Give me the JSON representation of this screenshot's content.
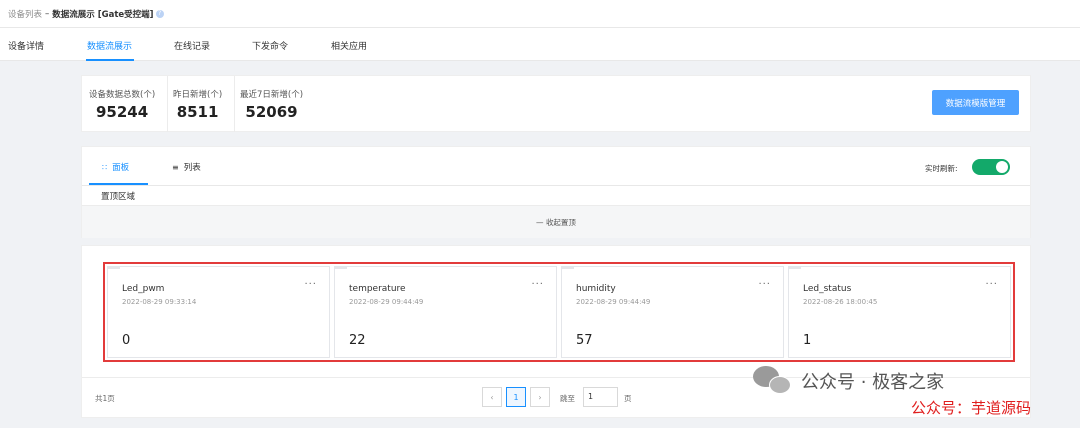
{
  "breadcrumb": {
    "parent": "设备列表",
    "separator": "–",
    "current": "数据流展示 [Gate受控端]",
    "help_glyph": "?"
  },
  "tabs": [
    {
      "label": "设备详情",
      "active": false
    },
    {
      "label": "数据流展示",
      "active": true
    },
    {
      "label": "在线记录",
      "active": false
    },
    {
      "label": "下发命令",
      "active": false
    },
    {
      "label": "相关应用",
      "active": false
    }
  ],
  "stats": [
    {
      "label": "设备数据总数(个)",
      "value": "95244"
    },
    {
      "label": "昨日新增(个)",
      "value": "8511"
    },
    {
      "label": "最近7日新增(个)",
      "value": "52069"
    }
  ],
  "template_button": "数据流模版管理",
  "view_tabs": [
    {
      "label": "面板",
      "icon": "grid-icon",
      "active": true
    },
    {
      "label": "列表",
      "icon": "list-icon",
      "active": false
    }
  ],
  "realtime": {
    "label": "实时刷新:",
    "enabled": true,
    "color": "#13a96a"
  },
  "pin_area_label": "置顶区域",
  "collapse_pin_label": "收起置顶",
  "datastreams": [
    {
      "name": "Led_pwm",
      "time": "2022-08-29 09:33:14",
      "value": "0"
    },
    {
      "name": "temperature",
      "time": "2022-08-29 09:44:49",
      "value": "22"
    },
    {
      "name": "humidity",
      "time": "2022-08-29 09:44:49",
      "value": "57"
    },
    {
      "name": "Led_status",
      "time": "2022-08-26 18:00:45",
      "value": "1"
    }
  ],
  "card_menu_glyph": "···",
  "pagination": {
    "total": "共1页",
    "prev": "‹",
    "current": "1",
    "next": "›",
    "jump_label": "跳至",
    "jump_value": "1",
    "suffix": "页"
  },
  "watermark": {
    "line1": "公众号 · 极客之家",
    "line2": "公众号：芋道源码"
  },
  "colors": {
    "accent": "#1890ff",
    "button": "#4ea1ff",
    "highlight": "#e23b3b",
    "watermark_red": "#e01e1e"
  }
}
